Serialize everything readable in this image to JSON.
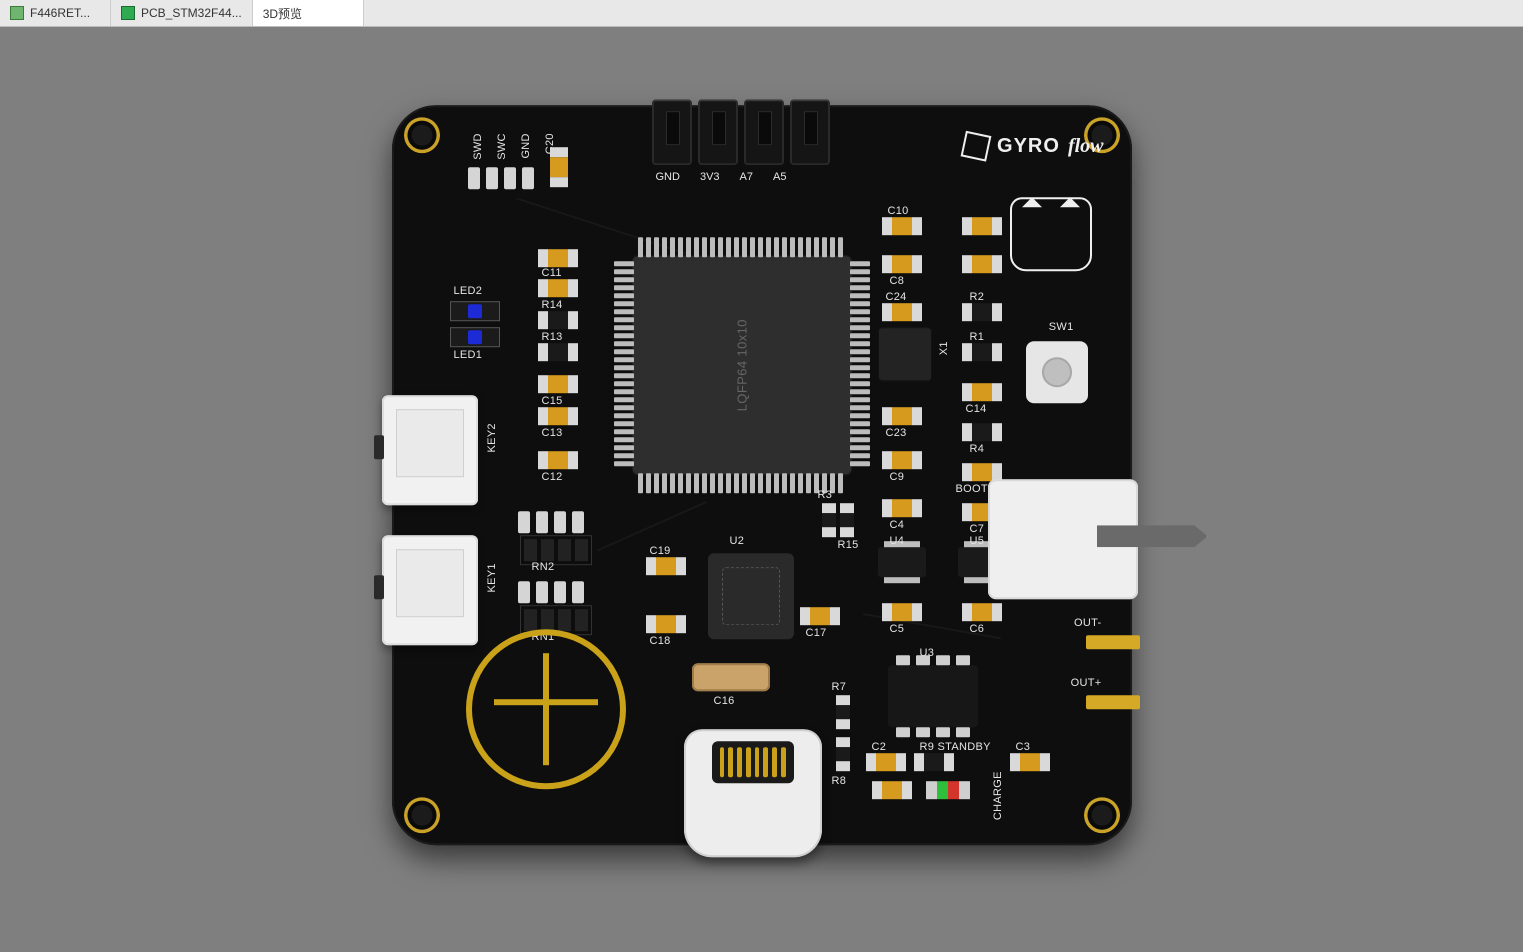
{
  "tabs": {
    "t0": "F446RET...",
    "t1": "PCB_STM32F44...",
    "t2": "3D预览"
  },
  "brand": {
    "g": "GYRO",
    "f": "flow"
  },
  "header_pins": {
    "p0": "GND",
    "p1": "3V3",
    "p2": "A7",
    "p3": "A5"
  },
  "mcu": {
    "marking": "LQFP64 10x10"
  },
  "silks": {
    "swd": "SWD",
    "swc": "SWC",
    "gnd": "GND",
    "c20": "C20",
    "led2": "LED2",
    "led1": "LED1",
    "c11": "C11",
    "r14": "R14",
    "r13": "R13",
    "c15": "C15",
    "c13": "C13",
    "c12": "C12",
    "rn2": "RN2",
    "rn1": "RN1",
    "key2": "KEY2",
    "key1": "KEY1",
    "c19": "C19",
    "c18": "C18",
    "c16": "C16",
    "c17": "C17",
    "u2": "U2",
    "r3": "R3",
    "r15": "R15",
    "c10": "C10",
    "c8": "C8",
    "c24": "C24",
    "x1": "X1",
    "c23": "C23",
    "c9": "C9",
    "c4": "C4",
    "u4": "U4",
    "c5": "C5",
    "r2": "R2",
    "r1": "R1",
    "c14": "C14",
    "r4": "R4",
    "boot0": "BOOT0",
    "c7": "C7",
    "u5": "U5",
    "c6": "C6",
    "sw1": "SW1",
    "outm": "OUT-",
    "outp": "OUT+",
    "u3": "U3",
    "c2": "C2",
    "r9": "R9",
    "c3": "C3",
    "r7": "R7",
    "r8": "R8",
    "standby": "STANDBY",
    "charge": "CHARGE"
  }
}
